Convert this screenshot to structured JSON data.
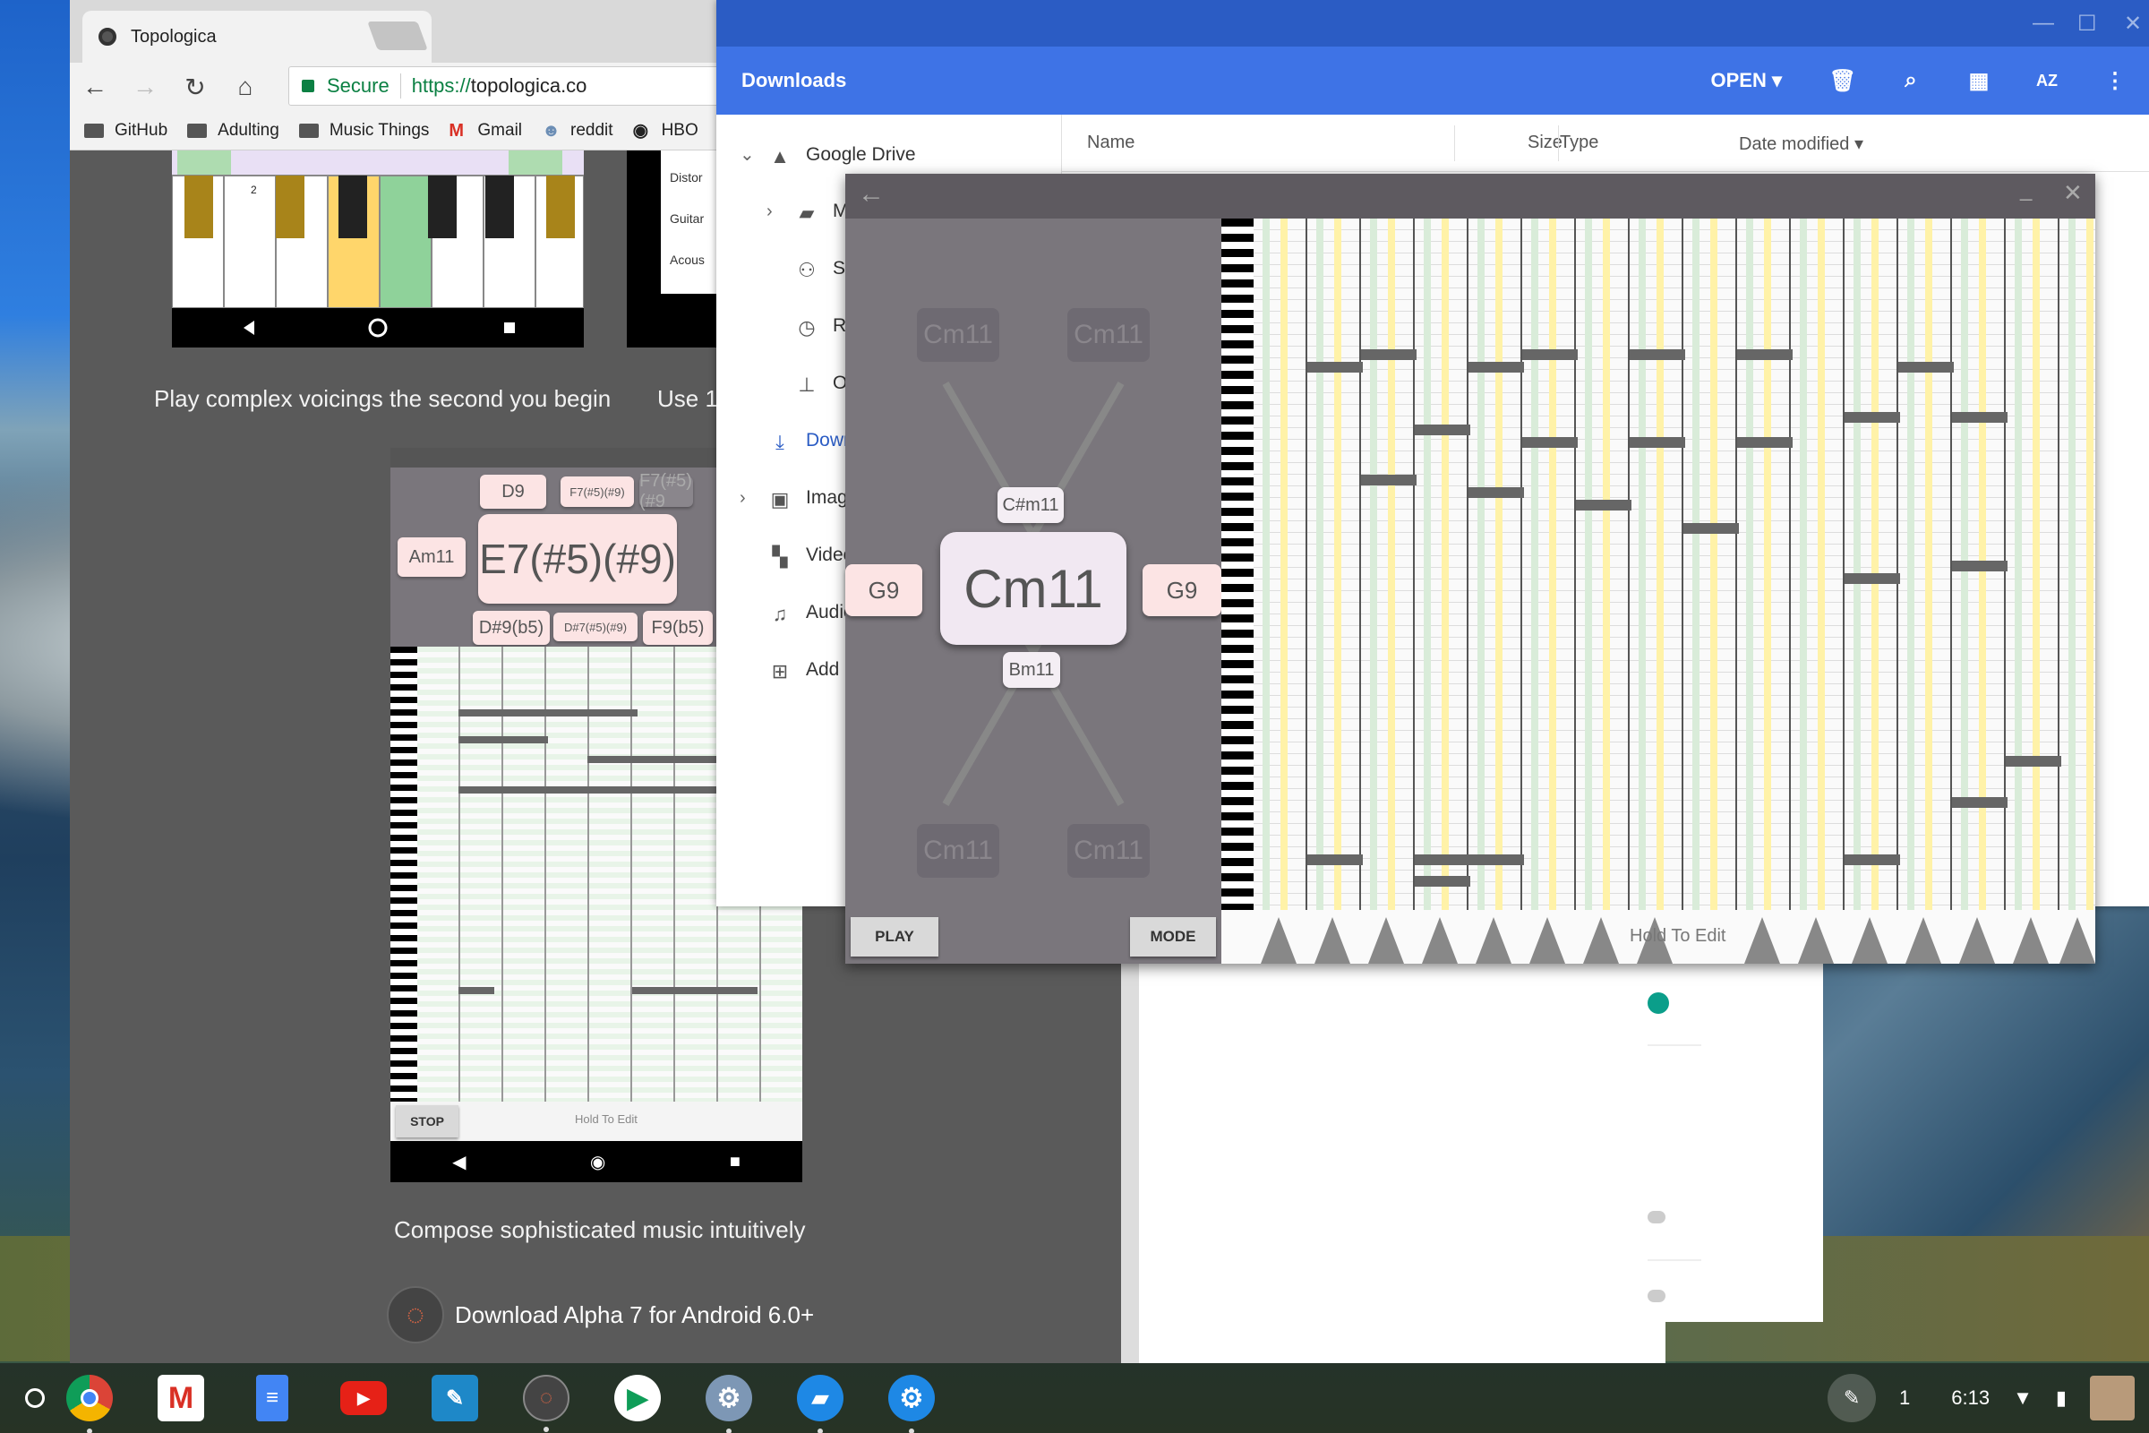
{
  "browser": {
    "tab_title": "Topologica",
    "secure_label": "Secure",
    "url_scheme": "https://",
    "url_host": "topologica.co",
    "bookmarks": [
      "GitHub",
      "Adulting",
      "Music Things",
      "Gmail",
      "reddit",
      "HBO"
    ]
  },
  "page": {
    "caption1": "Play complex voicings the second you begin",
    "caption2": "Use 1",
    "caption3": "Compose sophisticated music intuitively",
    "download_text": "Download Alpha 7 for Android 6.0+",
    "menu_items": [
      "Distor",
      "Guitar",
      "Acous"
    ],
    "phone_chords": {
      "top": "D9",
      "topright": "F7(#5)(#9)",
      "topright2": "F7(#5)(#9",
      "left": "Am11",
      "center": "E7(#5)(#9)",
      "bl": "D#9(b5)",
      "bm": "D#7(#5)(#9)",
      "br": "F9(b5)"
    },
    "phone_stop": "STOP",
    "phone_hold": "Hold To Edit",
    "key_number": "2"
  },
  "files": {
    "title": "Downloads",
    "open_label": "OPEN",
    "sort_label": "AZ",
    "sidebar": [
      {
        "label": "Google Drive",
        "icon": "drive-icon"
      },
      {
        "label": "My",
        "icon": "folder-icon"
      },
      {
        "label": "Sh",
        "icon": "people-icon"
      },
      {
        "label": "Re",
        "icon": "clock-icon"
      },
      {
        "label": "Of",
        "icon": "pin-icon"
      },
      {
        "label": "Downl",
        "icon": "download-icon"
      },
      {
        "label": "Image",
        "icon": "image-icon"
      },
      {
        "label": "Video",
        "icon": "video-icon"
      },
      {
        "label": "Audio",
        "icon": "audio-icon"
      },
      {
        "label": "Add n",
        "icon": "plus-icon"
      }
    ],
    "columns": {
      "name": "Name",
      "size": "Size",
      "type": "Type",
      "date": "Date modified"
    }
  },
  "chord_app": {
    "center": "Cm11",
    "upper": "C#m11",
    "lower": "Bm11",
    "left": "G9",
    "right": "G9",
    "corner": "Cm11",
    "play": "PLAY",
    "mode": "MODE",
    "hold": "Hold To Edit"
  },
  "shelf": {
    "time": "6:13",
    "notification_count": "1"
  },
  "colors": {
    "files_bar": "#3e73e6",
    "files_title": "#2b5cc4",
    "secure": "#0b8043",
    "chord_pink": "#fce4e4"
  }
}
